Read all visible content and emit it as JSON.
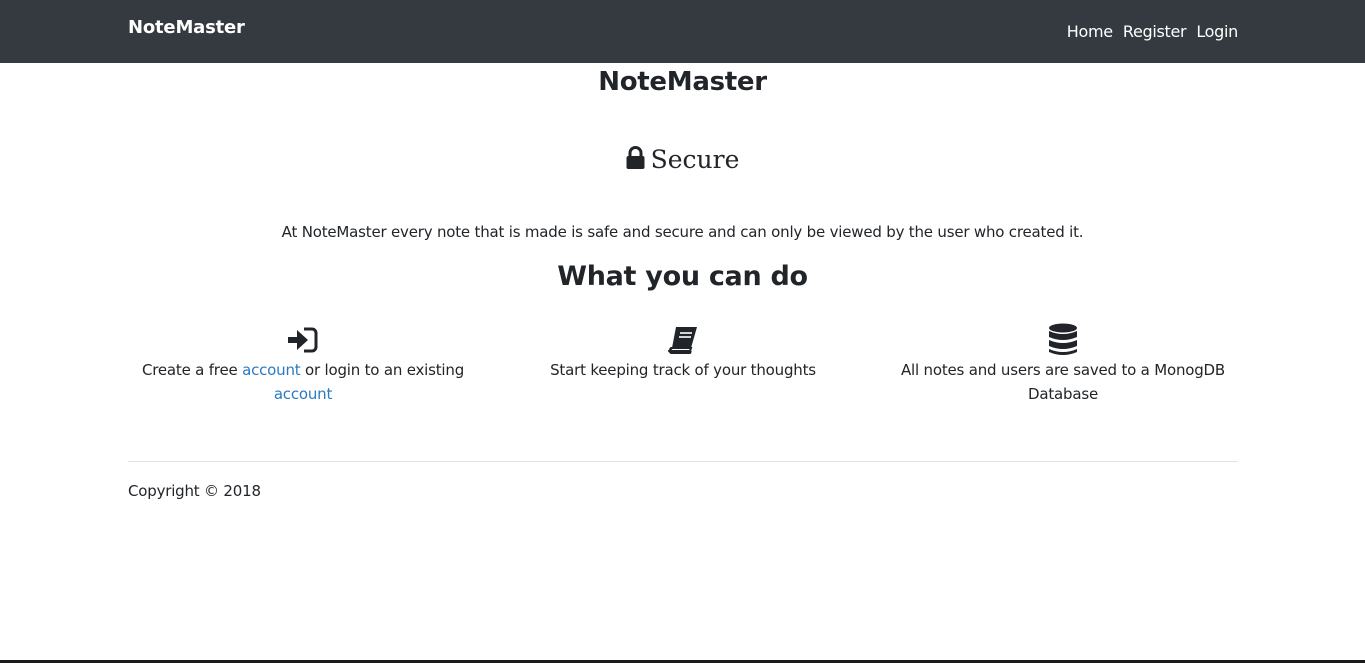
{
  "navbar": {
    "brand": "NoteMaster",
    "links": [
      "Home",
      "Register",
      "Login"
    ]
  },
  "main": {
    "title": "NoteMaster",
    "secure": {
      "icon": "lock-icon",
      "heading": "Secure",
      "text": "At NoteMaster every note that is made is safe and secure and can only be viewed by the user who created it."
    },
    "section_heading": "What you can do",
    "features": [
      {
        "icon": "sign-in-icon",
        "text_before": "Create a free ",
        "link1": "account",
        "text_middle": " or login to an existing ",
        "link2": "account"
      },
      {
        "icon": "book-icon",
        "text": "Start keeping track of your thoughts"
      },
      {
        "icon": "database-icon",
        "text": "All notes and users are saved to a MonogDB Database"
      }
    ]
  },
  "footer": {
    "copyright": "Copyright © 2018"
  },
  "colors": {
    "navbar_bg": "#343a40",
    "link": "#2a7ac0",
    "text": "#212529"
  }
}
